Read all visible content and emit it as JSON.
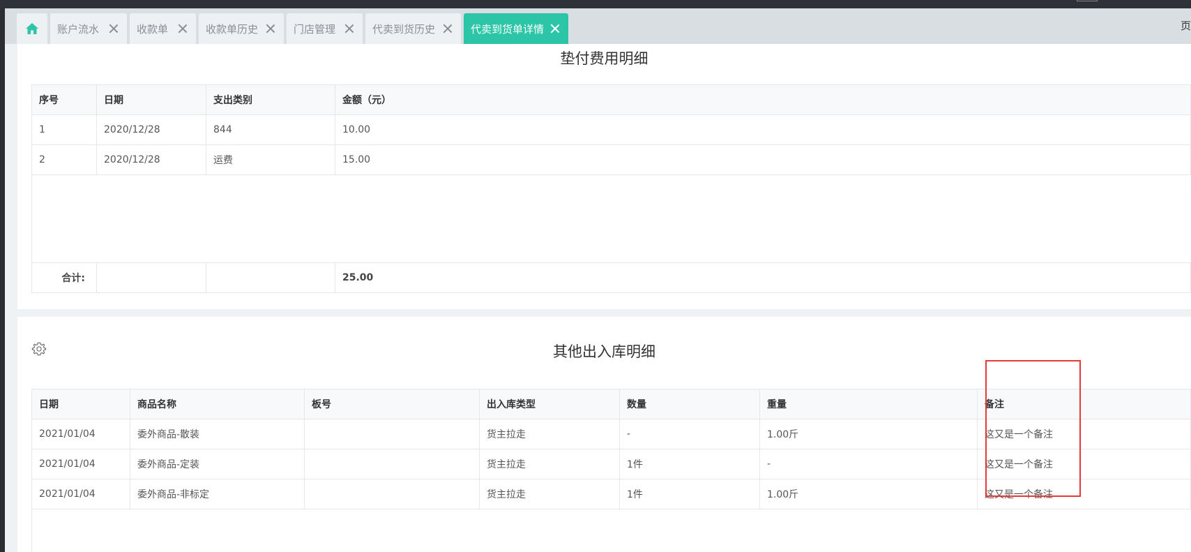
{
  "tabs": [
    {
      "label": "账户流水"
    },
    {
      "label": "收款单"
    },
    {
      "label": "收款单历史"
    },
    {
      "label": "门店管理"
    },
    {
      "label": "代卖到货历史"
    },
    {
      "label": "代卖到货单详情"
    }
  ],
  "tabbar_right_text": "页",
  "advance_fees": {
    "title": "垫付费用明细",
    "columns": [
      "序号",
      "日期",
      "支出类别",
      "金额（元）"
    ],
    "rows": [
      [
        "1",
        "2020/12/28",
        "844",
        "10.00"
      ],
      [
        "2",
        "2020/12/28",
        "运费",
        "15.00"
      ]
    ],
    "total_label": "合计:",
    "total_value": "25.00"
  },
  "other_io": {
    "title": "其他出入库明细",
    "columns": [
      "日期",
      "商品名称",
      "板号",
      "出入库类型",
      "数量",
      "重量",
      "备注"
    ],
    "rows": [
      [
        "2021/01/04",
        "委外商品-散装",
        "",
        "货主拉走",
        "-",
        "1.00斤",
        "这又是一个备注"
      ],
      [
        "2021/01/04",
        "委外商品-定装",
        "",
        "货主拉走",
        "1件",
        "-",
        "这又是一个备注"
      ],
      [
        "2021/01/04",
        "委外商品-非标定",
        "",
        "货主拉走",
        "1件",
        "1.00斤",
        "这又是一个备注"
      ]
    ]
  },
  "colors": {
    "active_tab": "#2dc5a8",
    "highlight_box": "#e53935"
  },
  "icons": {
    "home": "home-icon",
    "close": "close-icon",
    "settings": "gear-icon"
  }
}
